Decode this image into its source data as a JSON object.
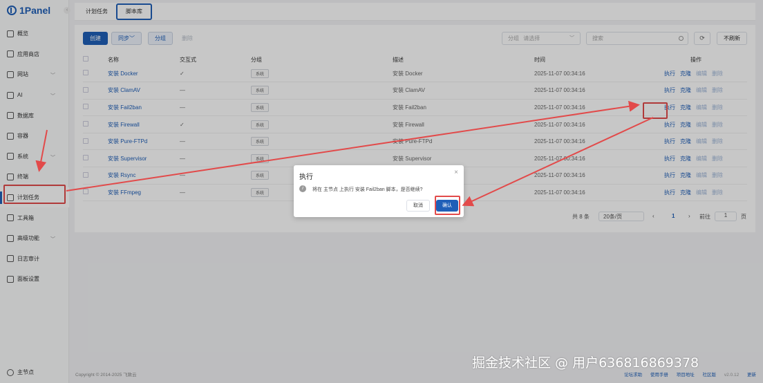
{
  "app": {
    "logo_text": "1Panel"
  },
  "sidebar": {
    "items": [
      {
        "label": "概览",
        "icon": "home-icon",
        "chevron": false
      },
      {
        "label": "应用商店",
        "icon": "grid-icon",
        "chevron": false
      },
      {
        "label": "网站",
        "icon": "globe-icon",
        "chevron": true
      },
      {
        "label": "AI",
        "icon": "robot-icon",
        "chevron": true
      },
      {
        "label": "数据库",
        "icon": "layers-icon",
        "chevron": false
      },
      {
        "label": "容器",
        "icon": "whale-icon",
        "chevron": false
      },
      {
        "label": "系统",
        "icon": "server-icon",
        "chevron": true
      },
      {
        "label": "终端",
        "icon": "terminal-icon",
        "chevron": false
      },
      {
        "label": "计划任务",
        "icon": "calendar-icon",
        "chevron": false,
        "active": true
      },
      {
        "label": "工具箱",
        "icon": "toolbox-icon",
        "chevron": false
      },
      {
        "label": "高级功能",
        "icon": "diamond-icon",
        "chevron": true
      },
      {
        "label": "日志审计",
        "icon": "log-icon",
        "chevron": false
      },
      {
        "label": "面板设置",
        "icon": "gear-icon",
        "chevron": false
      }
    ],
    "node_label": "主节点"
  },
  "tabs": [
    "计划任务",
    "脚本库"
  ],
  "toolbar": {
    "create": "创建",
    "sync": "同步",
    "group": "分组",
    "delete": "删除",
    "group_filter_label": "分组",
    "group_filter_placeholder": "请选择",
    "search_placeholder": "搜索",
    "no_refresh": "不刷新"
  },
  "table": {
    "headers": [
      "名称",
      "交互式",
      "分组",
      "描述",
      "时间",
      "操作"
    ],
    "rows": [
      {
        "name": "安装 Docker",
        "interactive": "✓",
        "group": "系统",
        "desc": "安装 Docker",
        "time": "2025-11-07 00:34:16"
      },
      {
        "name": "安装 ClamAV",
        "interactive": "—",
        "group": "系统",
        "desc": "安装 ClamAV",
        "time": "2025-11-07 00:34:16"
      },
      {
        "name": "安装 Fail2ban",
        "interactive": "—",
        "group": "系统",
        "desc": "安装 Fail2ban",
        "time": "2025-11-07 00:34:16"
      },
      {
        "name": "安装 Firewall",
        "interactive": "✓",
        "group": "系统",
        "desc": "安装 Firewall",
        "time": "2025-11-07 00:34:16"
      },
      {
        "name": "安装 Pure-FTPd",
        "interactive": "—",
        "group": "系统",
        "desc": "安装 Pure-FTPd",
        "time": "2025-11-07 00:34:16"
      },
      {
        "name": "安装 Supervisor",
        "interactive": "—",
        "group": "系统",
        "desc": "安装 Supervisor",
        "time": "2025-11-07 00:34:16"
      },
      {
        "name": "安装 Rsync",
        "interactive": "—",
        "group": "系统",
        "desc": "安装 Rsync",
        "time": "2025-11-07 00:34:16"
      },
      {
        "name": "安装 FFmpeg",
        "interactive": "—",
        "group": "系统",
        "desc": "安装 FFmpeg",
        "time": "2025-11-07 00:34:16"
      }
    ],
    "ops": [
      "执行",
      "克隆",
      "编辑",
      "删除"
    ]
  },
  "pager": {
    "total": "共 8 条",
    "page_size": "20条/页",
    "current_page": "1",
    "goto_label": "前往",
    "goto_value": "1",
    "page_suffix": "页"
  },
  "dialog": {
    "title": "执行",
    "message": "将在 主节点 上执行 安装 Fail2ban 脚本，是否继续?",
    "cancel": "取消",
    "confirm": "确认"
  },
  "footer": {
    "copyright": "Copyright © 2014-2025 飞致云",
    "links": [
      "论坛求助",
      "使用手册",
      "项目地址",
      "社区版",
      "v2.0.12",
      "更新"
    ]
  },
  "watermark": "掘金技术社区 @ 用户636816869378",
  "colors": {
    "primary": "#1f5fb8",
    "annotation": "#e24a4a"
  }
}
